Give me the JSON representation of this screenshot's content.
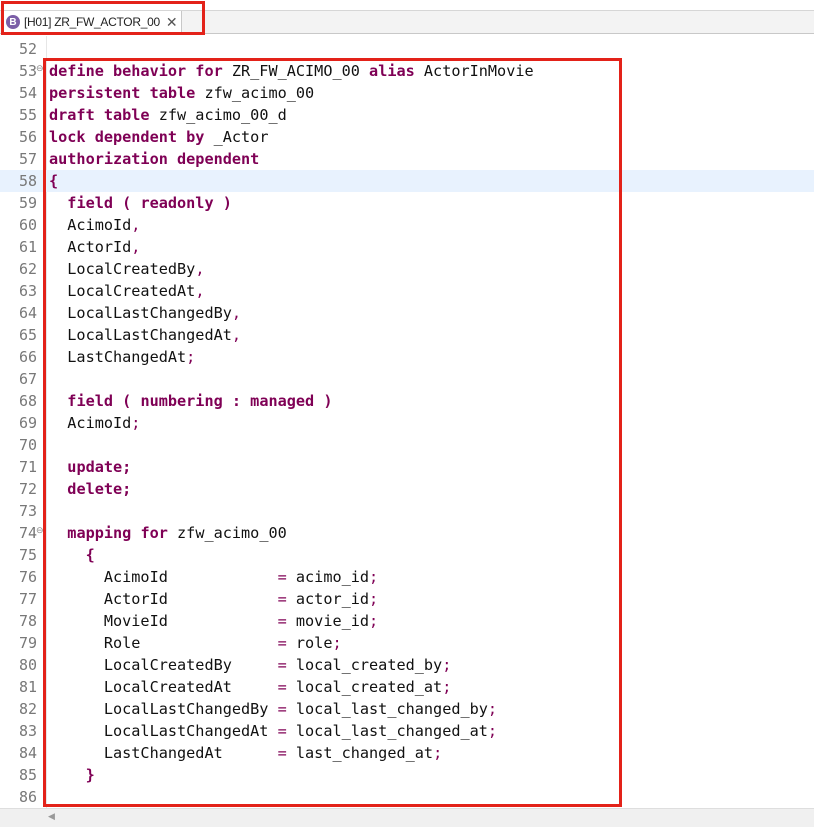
{
  "tab": {
    "icon_letter": "B",
    "title": "[H01] ZR_FW_ACTOR_00",
    "close_glyph": "✕"
  },
  "editor": {
    "current_line": 58,
    "lines": [
      {
        "n": "52",
        "fold": false,
        "tokens": []
      },
      {
        "n": "53",
        "fold": true,
        "tokens": [
          [
            "kw",
            "define behavior for"
          ],
          [
            "t",
            " ZR_FW_ACIMO_00 "
          ],
          [
            "kw",
            "alias"
          ],
          [
            "t",
            " ActorInMovie"
          ]
        ]
      },
      {
        "n": "54",
        "fold": false,
        "tokens": [
          [
            "kw",
            "persistent table"
          ],
          [
            "t",
            " zfw_acimo_00"
          ]
        ]
      },
      {
        "n": "55",
        "fold": false,
        "tokens": [
          [
            "kw",
            "draft table"
          ],
          [
            "t",
            " zfw_acimo_00_d"
          ]
        ]
      },
      {
        "n": "56",
        "fold": false,
        "tokens": [
          [
            "kw",
            "lock dependent by"
          ],
          [
            "t",
            " _Actor"
          ]
        ]
      },
      {
        "n": "57",
        "fold": false,
        "tokens": [
          [
            "kw",
            "authorization dependent"
          ]
        ]
      },
      {
        "n": "58",
        "fold": false,
        "tokens": [
          [
            "kw",
            "{"
          ]
        ]
      },
      {
        "n": "59",
        "fold": false,
        "tokens": [
          [
            "t",
            "  "
          ],
          [
            "kw",
            "field ( readonly )"
          ]
        ]
      },
      {
        "n": "60",
        "fold": false,
        "tokens": [
          [
            "t",
            "  AcimoId"
          ],
          [
            "sym",
            ","
          ]
        ]
      },
      {
        "n": "61",
        "fold": false,
        "tokens": [
          [
            "t",
            "  ActorId"
          ],
          [
            "sym",
            ","
          ]
        ]
      },
      {
        "n": "62",
        "fold": false,
        "tokens": [
          [
            "t",
            "  LocalCreatedBy"
          ],
          [
            "sym",
            ","
          ]
        ]
      },
      {
        "n": "63",
        "fold": false,
        "tokens": [
          [
            "t",
            "  LocalCreatedAt"
          ],
          [
            "sym",
            ","
          ]
        ]
      },
      {
        "n": "64",
        "fold": false,
        "tokens": [
          [
            "t",
            "  LocalLastChangedBy"
          ],
          [
            "sym",
            ","
          ]
        ]
      },
      {
        "n": "65",
        "fold": false,
        "tokens": [
          [
            "t",
            "  LocalLastChangedAt"
          ],
          [
            "sym",
            ","
          ]
        ]
      },
      {
        "n": "66",
        "fold": false,
        "tokens": [
          [
            "t",
            "  LastChangedAt"
          ],
          [
            "sym",
            ";"
          ]
        ]
      },
      {
        "n": "67",
        "fold": false,
        "tokens": []
      },
      {
        "n": "68",
        "fold": false,
        "tokens": [
          [
            "t",
            "  "
          ],
          [
            "kw",
            "field ( numbering : managed )"
          ]
        ]
      },
      {
        "n": "69",
        "fold": false,
        "tokens": [
          [
            "t",
            "  AcimoId"
          ],
          [
            "sym",
            ";"
          ]
        ]
      },
      {
        "n": "70",
        "fold": false,
        "tokens": []
      },
      {
        "n": "71",
        "fold": false,
        "tokens": [
          [
            "t",
            "  "
          ],
          [
            "kw",
            "update;"
          ]
        ]
      },
      {
        "n": "72",
        "fold": false,
        "tokens": [
          [
            "t",
            "  "
          ],
          [
            "kw",
            "delete;"
          ]
        ]
      },
      {
        "n": "73",
        "fold": false,
        "tokens": []
      },
      {
        "n": "74",
        "fold": true,
        "tokens": [
          [
            "t",
            "  "
          ],
          [
            "kw",
            "mapping for"
          ],
          [
            "t",
            " zfw_acimo_00"
          ]
        ]
      },
      {
        "n": "75",
        "fold": false,
        "tokens": [
          [
            "t",
            "    "
          ],
          [
            "kw",
            "{"
          ]
        ]
      },
      {
        "n": "76",
        "fold": false,
        "tokens": [
          [
            "t",
            "      AcimoId            "
          ],
          [
            "sym",
            "="
          ],
          [
            "t",
            " acimo_id"
          ],
          [
            "sym",
            ";"
          ]
        ]
      },
      {
        "n": "77",
        "fold": false,
        "tokens": [
          [
            "t",
            "      ActorId            "
          ],
          [
            "sym",
            "="
          ],
          [
            "t",
            " actor_id"
          ],
          [
            "sym",
            ";"
          ]
        ]
      },
      {
        "n": "78",
        "fold": false,
        "tokens": [
          [
            "t",
            "      MovieId            "
          ],
          [
            "sym",
            "="
          ],
          [
            "t",
            " movie_id"
          ],
          [
            "sym",
            ";"
          ]
        ]
      },
      {
        "n": "79",
        "fold": false,
        "tokens": [
          [
            "t",
            "      Role               "
          ],
          [
            "sym",
            "="
          ],
          [
            "t",
            " role"
          ],
          [
            "sym",
            ";"
          ]
        ]
      },
      {
        "n": "80",
        "fold": false,
        "tokens": [
          [
            "t",
            "      LocalCreatedBy     "
          ],
          [
            "sym",
            "="
          ],
          [
            "t",
            " local_created_by"
          ],
          [
            "sym",
            ";"
          ]
        ]
      },
      {
        "n": "81",
        "fold": false,
        "tokens": [
          [
            "t",
            "      LocalCreatedAt     "
          ],
          [
            "sym",
            "="
          ],
          [
            "t",
            " local_created_at"
          ],
          [
            "sym",
            ";"
          ]
        ]
      },
      {
        "n": "82",
        "fold": false,
        "tokens": [
          [
            "t",
            "      LocalLastChangedBy "
          ],
          [
            "sym",
            "="
          ],
          [
            "t",
            " local_last_changed_by"
          ],
          [
            "sym",
            ";"
          ]
        ]
      },
      {
        "n": "83",
        "fold": false,
        "tokens": [
          [
            "t",
            "      LocalLastChangedAt "
          ],
          [
            "sym",
            "="
          ],
          [
            "t",
            " local_last_changed_at"
          ],
          [
            "sym",
            ";"
          ]
        ]
      },
      {
        "n": "84",
        "fold": false,
        "tokens": [
          [
            "t",
            "      LastChangedAt      "
          ],
          [
            "sym",
            "="
          ],
          [
            "t",
            " last_changed_at"
          ],
          [
            "sym",
            ";"
          ]
        ]
      },
      {
        "n": "85",
        "fold": false,
        "tokens": [
          [
            "t",
            "    "
          ],
          [
            "kw",
            "}"
          ]
        ]
      },
      {
        "n": "86",
        "fold": false,
        "tokens": []
      }
    ]
  },
  "colors": {
    "keyword": "#7f0055",
    "highlight_border": "#e32219",
    "current_line": "#e8f2fe"
  },
  "icons": {
    "fold": "fold-collapse-icon",
    "scroll_left": "scroll-left-arrow-icon"
  }
}
